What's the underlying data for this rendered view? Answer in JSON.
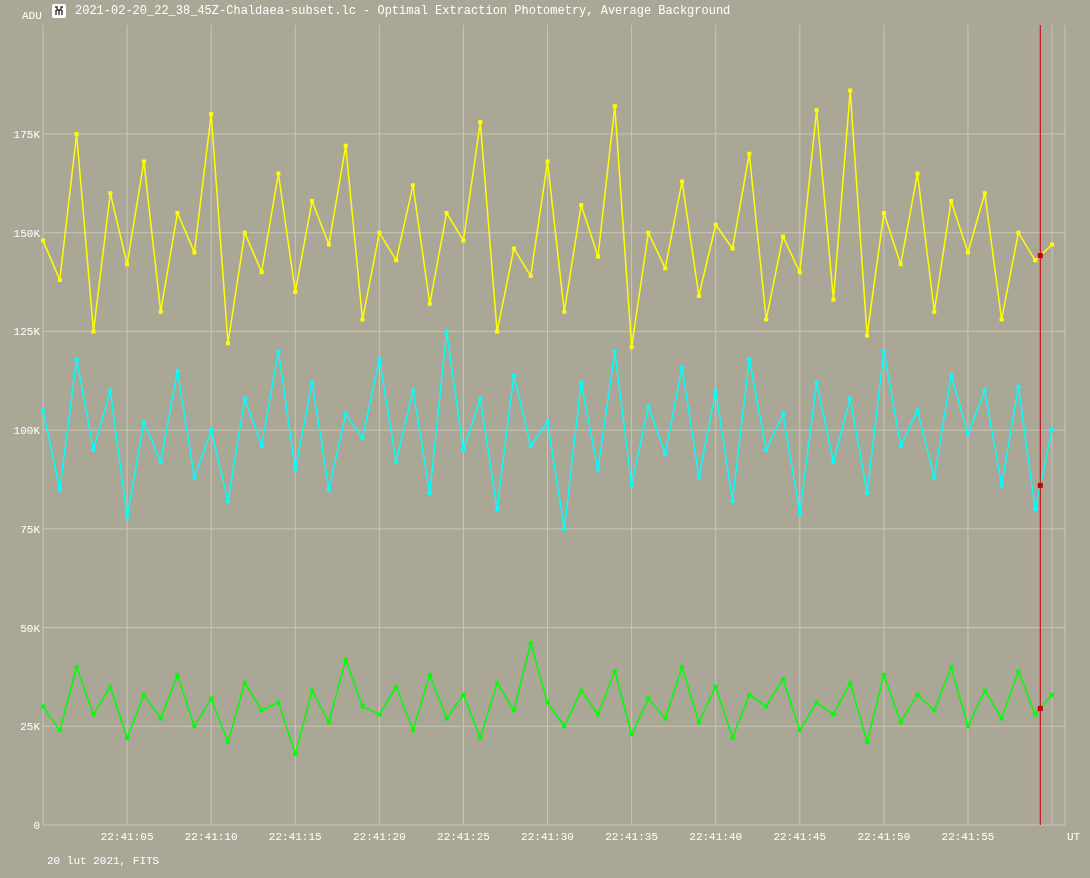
{
  "window": {
    "title": "2021-02-20_22_38_45Z-Chaldaea-subset.lc - Optimal Extraction Photometry, Average Background"
  },
  "chart": {
    "chart_data": {
      "type": "line",
      "ylabel": "ADU",
      "xlabel": "UT",
      "ylim": [
        0,
        202.6
      ],
      "categories": [
        null,
        null,
        null,
        null,
        null,
        "22:41:05",
        null,
        null,
        null,
        null,
        "22:41:10",
        null,
        null,
        null,
        null,
        "22:41:15",
        null,
        null,
        null,
        null,
        "22:41:20",
        null,
        null,
        null,
        null,
        "22:41:25",
        null,
        null,
        null,
        null,
        "22:41:30",
        null,
        null,
        null,
        null,
        "22:41:35",
        null,
        null,
        null,
        null,
        "22:41:40",
        null,
        null,
        null,
        null,
        "22:41:45",
        null,
        null,
        null,
        null,
        "22:41:50",
        null,
        null,
        null,
        null,
        "22:41:55",
        null,
        null,
        null,
        null,
        null
      ],
      "yticks": [
        {
          "value": 0,
          "label": "0"
        },
        {
          "value": 25,
          "label": "25K"
        },
        {
          "value": 50,
          "label": "50K"
        },
        {
          "value": 75,
          "label": "75K"
        },
        {
          "value": 100,
          "label": "100K"
        },
        {
          "value": 125,
          "label": "125K"
        },
        {
          "value": 150,
          "label": "150K"
        },
        {
          "value": 175,
          "label": "175K"
        }
      ],
      "series": [
        {
          "color": "#ffff00",
          "marker": "square",
          "values": [
            148,
            138,
            175,
            125,
            160,
            142,
            168,
            130,
            155,
            145,
            180,
            122,
            150,
            140,
            165,
            135,
            158,
            147,
            172,
            128,
            150,
            143,
            162,
            132,
            155,
            148,
            178,
            125,
            146,
            139,
            168,
            130,
            157,
            144,
            182,
            121,
            150,
            141,
            163,
            134,
            152,
            146,
            170,
            128,
            149,
            140,
            181,
            133,
            186,
            124,
            155,
            142,
            165,
            130,
            158,
            145,
            160,
            128,
            150,
            143,
            147
          ]
        },
        {
          "color": "#00ffff",
          "marker": "square",
          "values": [
            105,
            85,
            118,
            95,
            110,
            78,
            102,
            92,
            115,
            88,
            100,
            82,
            108,
            96,
            120,
            90,
            112,
            85,
            104,
            98,
            118,
            92,
            110,
            84,
            125,
            95,
            108,
            80,
            114,
            96,
            102,
            75,
            112,
            90,
            120,
            86,
            106,
            94,
            116,
            88,
            110,
            82,
            118,
            95,
            104,
            79,
            112,
            92,
            108,
            84,
            120,
            96,
            105,
            88,
            114,
            99,
            110,
            86,
            111,
            80,
            100
          ]
        },
        {
          "color": "#00ff00",
          "marker": "square",
          "values": [
            30,
            24,
            40,
            28,
            35,
            22,
            33,
            27,
            38,
            25,
            32,
            21,
            36,
            29,
            31,
            18,
            34,
            26,
            42,
            30,
            28,
            35,
            24,
            38,
            27,
            33,
            22,
            36,
            29,
            46,
            31,
            25,
            34,
            28,
            39,
            23,
            32,
            27,
            40,
            26,
            35,
            22,
            33,
            30,
            37,
            24,
            31,
            28,
            36,
            21,
            38,
            26,
            33,
            29,
            40,
            25,
            34,
            27,
            39,
            28,
            33
          ]
        }
      ],
      "grid": true
    }
  },
  "footer": {
    "text": "20 lut 2021, FITS"
  }
}
